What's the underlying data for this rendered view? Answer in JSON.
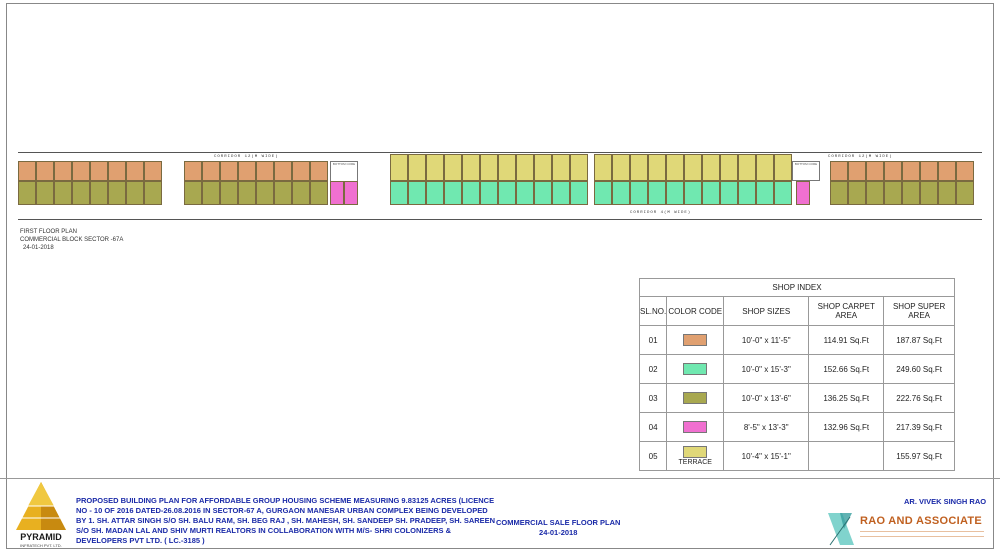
{
  "plan": {
    "corridor_top_left": "CORRIDOR 12(M WIDE)",
    "corridor_top_right": "CORRIDOR 12(M WIDE)",
    "corridor_bottom": "CORRIDOR 4(M WIDE)",
    "core_label": "BOTTOM CORE",
    "caption_line1": "FIRST FLOOR PLAN",
    "caption_line2": "COMMERCIAL BLOCK SECTOR -67A",
    "caption_date": "24-01-2018"
  },
  "shop_index": {
    "title": "SHOP INDEX",
    "headers": [
      "SL.NO.",
      "COLOR CODE",
      "SHOP SIZES",
      "SHOP CARPET AREA",
      "SHOP SUPER AREA"
    ],
    "rows": [
      {
        "sl": "01",
        "color": "#e0a070",
        "color_label": "",
        "size": "10'-0\" x 11'-5\"",
        "carpet": "114.91 Sq.Ft",
        "super": "187.87 Sq.Ft"
      },
      {
        "sl": "02",
        "color": "#70e8b0",
        "color_label": "",
        "size": "10'-0\" x 15'-3\"",
        "carpet": "152.66 Sq.Ft",
        "super": "249.60 Sq.Ft"
      },
      {
        "sl": "03",
        "color": "#a8a850",
        "color_label": "",
        "size": "10'-0\" x 13'-6\"",
        "carpet": "136.25 Sq.Ft",
        "super": "222.76 Sq.Ft"
      },
      {
        "sl": "04",
        "color": "#f070d0",
        "color_label": "",
        "size": "8'-5\" x 13'-3\"",
        "carpet": "132.96 Sq.Ft",
        "super": "217.39 Sq.Ft"
      },
      {
        "sl": "05",
        "color": "#e0d878",
        "color_label": "TERRACE",
        "size": "10'-4\" x 15'-1\"",
        "carpet": "",
        "super": "155.97 Sq.Ft"
      }
    ]
  },
  "title_block": {
    "logo_text": "PYRAMID",
    "logo_sub": "INFRATECH PVT. LTD.",
    "proposal": "PROPOSED BUILDING PLAN FOR AFFORDABLE GROUP HOUSING SCHEME MEASURING 9.83125 ACRES (LICENCE NO - 10 OF 2016 DATED-26.08.2016 IN SECTOR-67 A, GURGAON MANESAR URBAN COMPLEX BEING DEVELOPED BY 1. SH. ATTAR SINGH S/O SH. BALU RAM, SH. BEG RAJ , SH. MAHESH, SH. SANDEEP SH. PRADEEP, SH. SAREEN S/O SH. MADAN LAL AND SHIV MURTI REALTORS IN COLLABORATION WITH M/S- SHRI COLONIZERS & DEVELOPERS PVT LTD. ( LC.-3185 )",
    "drawing_title": "COMMERCIAL SALE FLOOR PLAN",
    "drawing_date": "24-01-2018",
    "architect": "AR. VIVEK SINGH RAO",
    "firm": "RAO AND ASSOCIATE"
  }
}
